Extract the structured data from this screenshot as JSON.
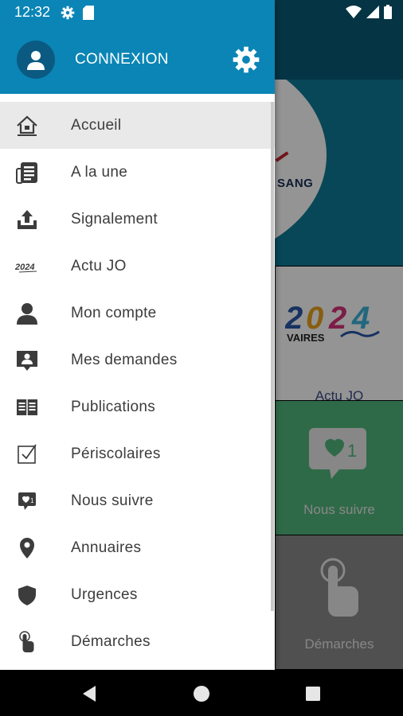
{
  "status_bar": {
    "time": "12:32",
    "left_icons": [
      "settings-icon",
      "sim-card-icon"
    ],
    "right_icons": [
      "wifi-icon",
      "signal-icon",
      "battery-icon"
    ]
  },
  "drawer": {
    "header": {
      "login_label": "CONNEXION",
      "avatar_icon": "user-icon",
      "settings_icon": "gear-icon",
      "color": "#0a85b6"
    },
    "items": [
      {
        "label": "Accueil",
        "icon": "home-icon",
        "active": true
      },
      {
        "label": "A la une",
        "icon": "newspaper-icon"
      },
      {
        "label": "Signalement",
        "icon": "upload-icon"
      },
      {
        "label": "Actu JO",
        "icon": "jo-2024-icon",
        "icon_text": "2024"
      },
      {
        "label": "Mon compte",
        "icon": "user-icon"
      },
      {
        "label": "Mes demandes",
        "icon": "user-message-icon"
      },
      {
        "label": "Publications",
        "icon": "book-icon"
      },
      {
        "label": "Périscolaires",
        "icon": "checkbox-icon"
      },
      {
        "label": "Nous suivre",
        "icon": "heart-chat-icon"
      },
      {
        "label": "Annuaires",
        "icon": "map-pin-icon"
      },
      {
        "label": "Urgences",
        "icon": "shield-icon"
      },
      {
        "label": "Démarches",
        "icon": "hand-pointer-icon"
      }
    ]
  },
  "background": {
    "banner_text": "SANG",
    "tiles": [
      {
        "label": "Actu JO",
        "logo_year": "2024",
        "logo_city": "VAIRES"
      },
      {
        "label": "Nous suivre",
        "badge_count": "1"
      },
      {
        "label": "Démarches"
      }
    ]
  },
  "navbar": {
    "icons": [
      "back-icon",
      "home-circle-icon",
      "recents-icon"
    ]
  }
}
